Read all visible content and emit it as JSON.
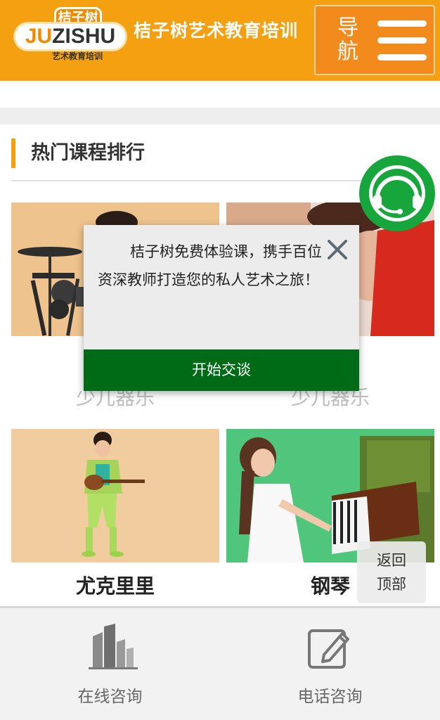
{
  "header": {
    "logo": {
      "top": "桔子树",
      "brand_ju": "JU",
      "brand_rest": "ZISHU",
      "sub": "艺术教育培训"
    },
    "title": "桔子树艺术教育培训",
    "nav_label": "导航"
  },
  "section": {
    "title": "热门课程排行"
  },
  "courses": [
    {
      "label": "少儿器乐"
    },
    {
      "label": "少儿器乐"
    },
    {
      "label": "尤克里里"
    },
    {
      "label": "钢琴"
    }
  ],
  "popup": {
    "message": "桔子树免费体验课，携手百位资深教师打造您的私人艺术之旅！",
    "button": "开始交谈"
  },
  "back_to_top": {
    "line1": "返回",
    "line2": "顶部"
  },
  "bottom_bar": [
    {
      "label": "在线咨询",
      "icon": "building-icon"
    },
    {
      "label": "电话咨询",
      "icon": "edit-icon"
    }
  ],
  "colors": {
    "header": "#f5a010",
    "nav_button": "#f28a1c",
    "chat": "#17a63c",
    "popup_button": "#006b17"
  }
}
